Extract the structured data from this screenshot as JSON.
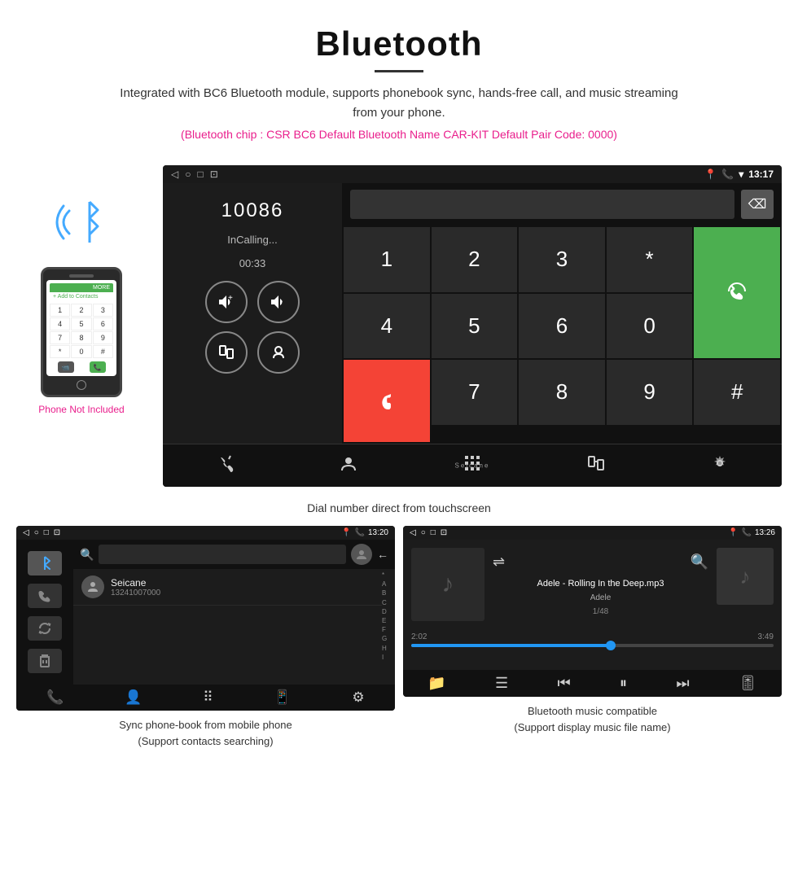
{
  "header": {
    "title": "Bluetooth",
    "description": "Integrated with BC6 Bluetooth module, supports phonebook sync, hands-free call, and music streaming from your phone.",
    "specs": "(Bluetooth chip : CSR BC6    Default Bluetooth Name CAR-KIT    Default Pair Code: 0000)"
  },
  "phone": {
    "not_included": "Phone Not Included"
  },
  "car_screen": {
    "status_bar": {
      "time": "13:17",
      "nav_buttons": [
        "◁",
        "○",
        "□",
        "⊡"
      ]
    },
    "caller_number": "10086",
    "calling_status": "InCalling...",
    "call_timer": "00:33",
    "numpad": [
      "1",
      "2",
      "3",
      "*",
      "4",
      "5",
      "6",
      "0",
      "7",
      "8",
      "9",
      "#"
    ],
    "watermark": "Seicane"
  },
  "caption_main": "Dial number direct from touchscreen",
  "phonebook_screen": {
    "status_bar": {
      "time": "13:20"
    },
    "contact_name": "Seicane",
    "contact_number": "13241007000",
    "letters": [
      "*",
      "A",
      "B",
      "C",
      "D",
      "E",
      "F",
      "G",
      "H",
      "I"
    ]
  },
  "caption_phonebook_1": "Sync phone-book from mobile phone",
  "caption_phonebook_2": "(Support contacts searching)",
  "music_screen": {
    "status_bar": {
      "time": "13:26"
    },
    "track_name": "Adele - Rolling In the Deep.mp3",
    "artist": "Adele",
    "track_count": "1/48",
    "time_current": "2:02",
    "time_total": "3:49",
    "progress_percent": 55
  },
  "caption_music_1": "Bluetooth music compatible",
  "caption_music_2": "(Support display music file name)"
}
